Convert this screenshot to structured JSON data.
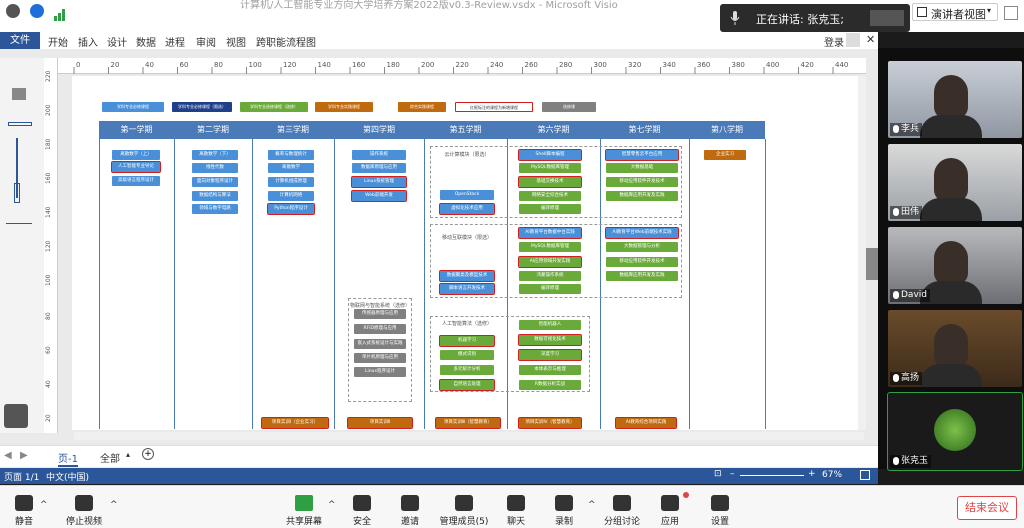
{
  "window": {
    "title": "计算机/人工智能专业方向大学培养方案2022版v0.3-Review.vsdx - Microsoft Visio"
  },
  "meeting": {
    "speaking_label": "正在讲话: 张克玉;",
    "view_button": "演讲者视图",
    "end_button": "结束会议"
  },
  "ribbon": {
    "tabs": [
      "文件",
      "开始",
      "插入",
      "设计",
      "数据",
      "进程",
      "审阅",
      "视图",
      "跨职能流程图"
    ],
    "login": "登录"
  },
  "ruler": {
    "h_ticks": [
      "0",
      "20",
      "40",
      "60",
      "80",
      "100",
      "120",
      "140",
      "160",
      "180",
      "200",
      "220",
      "240",
      "260",
      "280",
      "300",
      "320",
      "340",
      "360",
      "380",
      "400",
      "420",
      "440"
    ],
    "v_ticks": [
      "220",
      "200",
      "180",
      "160",
      "140",
      "120",
      "100",
      "80",
      "60",
      "40",
      "20"
    ]
  },
  "legend": [
    {
      "label": "学科专业必修课程",
      "color": "#4a90d9"
    },
    {
      "label": "学科专业必修课程（限选）",
      "color": "#1f3f8a"
    },
    {
      "label": "学科专业选修课程（选修）",
      "color": "#6aaa3a"
    },
    {
      "label": "学科专业实践课程",
      "color": "#c06a10"
    },
    {
      "label": "综合实践课程",
      "color": "#c06a10"
    },
    {
      "label": "红框标注的课程为新增课程",
      "color": "#ffffff"
    },
    {
      "label": "选修课",
      "color": "#808080"
    }
  ],
  "semesters": [
    "第一学期",
    "第二学期",
    "第三学期",
    "第四学期",
    "第五学期",
    "第六学期",
    "第七学期",
    "第八学期"
  ],
  "groups": [
    "云计算模块（限选）",
    "移动互联模块（限选）",
    "物联网与智能系统（选修）",
    "人工智能算法（选修）"
  ],
  "courses": {
    "s1": [
      "离散数学（上）",
      "人工智能专业导论",
      "高级语言程序设计"
    ],
    "s2": [
      "离散数学（下）",
      "线性代数",
      "面向对象程序设计",
      "数据结构与算法",
      "领域与数字电路"
    ],
    "s3": [
      "概率与数理统计",
      "离散数学",
      "计算机组成原理",
      "计算机网络",
      "Python程序设计"
    ],
    "s4": [
      "操作系统",
      "数据库原理与应用",
      "Linux系统管理",
      "Web前端开发"
    ],
    "s5": [
      "OpenStack",
      "虚拟化技术应用",
      "数据聚类及模型技术",
      "脚本语言开发技术",
      "机器学习",
      "模式识别",
      "多元统计分析",
      "自然语言处理"
    ],
    "s6": [
      "Shell脚本编程",
      "MySQL数据库管理",
      "基础交换技术",
      "网络安全综合技术",
      "编译原理",
      "AI教育平台数据中台实践",
      "MySQL数据库管理",
      "AI应用领域开发实践",
      "鸿蒙操作系统",
      "编译原理",
      "智能机器人",
      "数据可视化技术",
      "深度学习",
      "本体表示与推理",
      "R数据分析实战"
    ],
    "s7": [
      "智慧零售云平台应用",
      "大数据基础",
      "移动应用软件开发技术",
      "数据库应用开发及实践",
      "AI教育平台Web前端技术实践",
      "大数据管理与分析",
      "移动应用软件开发技术",
      "数据库应用开发及实践"
    ],
    "s8": [
      "企业实习"
    ],
    "iot": [
      "传感器原理与应用",
      "RFID原理与应用",
      "嵌入式系统设计与实践",
      "单片机原理与应用",
      "Linux程序设计"
    ],
    "practice": [
      "项目实训Ⅰ（企业实习）",
      "项目实训Ⅱ",
      "项目实训Ⅲ（智慧教育）",
      "项目实训Ⅳ（智慧教育）",
      "AI教育综合项目实践"
    ]
  },
  "visio": {
    "page_tab": "页-1",
    "all_tab": "全部",
    "status": "页面 1/1",
    "lang": "中文(中国)",
    "zoom": "67%"
  },
  "participants": [
    "李兵",
    "田伟",
    "David",
    "高扬",
    "张克玉"
  ],
  "toolbar": [
    "静音",
    "停止视频",
    "共享屏幕",
    "安全",
    "邀请",
    "管理成员(5)",
    "聊天",
    "录制",
    "分组讨论",
    "应用",
    "设置"
  ],
  "colors": {
    "accent": "#2b579a",
    "end": "#e04545"
  }
}
